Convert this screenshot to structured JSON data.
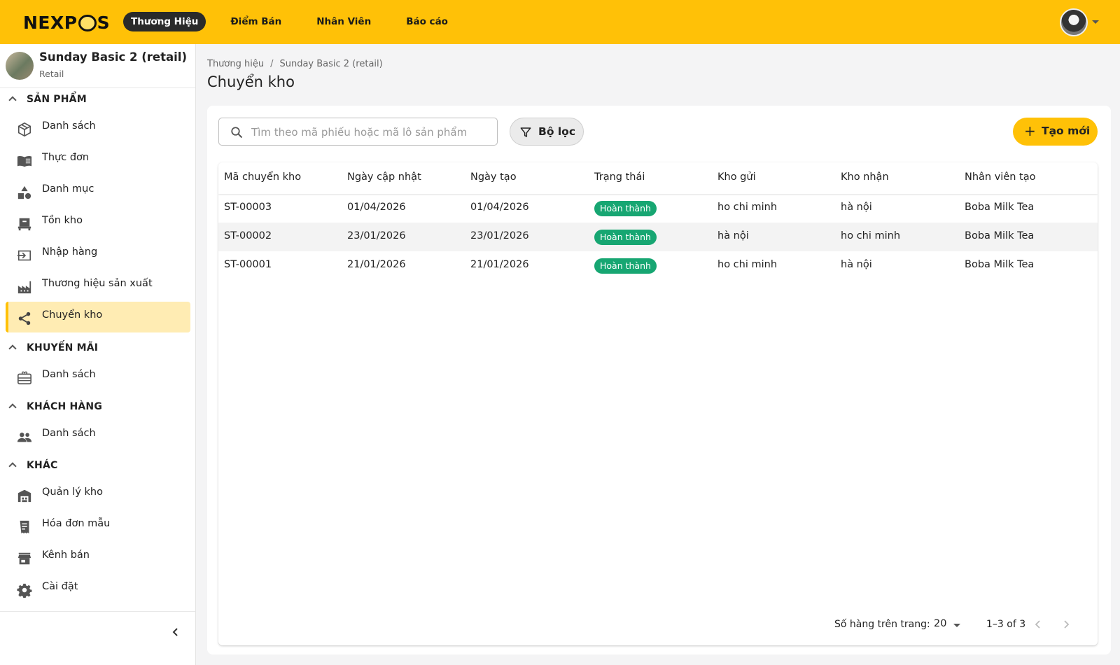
{
  "header": {
    "logo_text": "NEXPOS",
    "nav": [
      {
        "label": "Thương Hiệu",
        "active": true
      },
      {
        "label": "Điểm Bán",
        "active": false
      },
      {
        "label": "Nhân Viên",
        "active": false
      },
      {
        "label": "Báo cáo",
        "active": false
      }
    ],
    "accent_color": "#ffc107"
  },
  "store": {
    "name": "Sunday Basic 2 (retail)",
    "type": "Retail"
  },
  "sidebar": {
    "sections": [
      {
        "title": "SẢN PHẨM",
        "items": [
          {
            "label": "Danh sách",
            "icon": "box-icon"
          },
          {
            "label": "Thực đơn",
            "icon": "menu-book-icon"
          },
          {
            "label": "Danh mục",
            "icon": "category-shapes-icon"
          },
          {
            "label": "Tồn kho",
            "icon": "inventory-icon"
          },
          {
            "label": "Nhập hàng",
            "icon": "import-icon"
          },
          {
            "label": "Thương hiệu sản xuất",
            "icon": "factory-icon"
          },
          {
            "label": "Chuyển kho",
            "icon": "share-icon",
            "active": true
          }
        ]
      },
      {
        "title": "KHUYẾN MÃI",
        "items": [
          {
            "label": "Danh sách",
            "icon": "gift-card-icon"
          }
        ]
      },
      {
        "title": "KHÁCH HÀNG",
        "items": [
          {
            "label": "Danh sách",
            "icon": "people-icon"
          }
        ]
      },
      {
        "title": "KHÁC",
        "items": [
          {
            "label": "Quản lý kho",
            "icon": "warehouse-icon"
          },
          {
            "label": "Hóa đơn mẫu",
            "icon": "receipt-icon"
          },
          {
            "label": "Kênh bán",
            "icon": "store-icon"
          },
          {
            "label": "Cài đặt",
            "icon": "gear-icon"
          }
        ]
      }
    ]
  },
  "breadcrumb": [
    "Thương hiệu",
    "Sunday Basic 2 (retail)"
  ],
  "page_title": "Chuyển kho",
  "toolbar": {
    "search_placeholder": "Tìm theo mã phiếu hoặc mã lô sản phẩm",
    "search_value": "",
    "filter_label": "Bộ lọc",
    "create_label": "Tạo mới"
  },
  "table": {
    "columns": [
      "Mã chuyển kho",
      "Ngày cập nhật",
      "Ngày tạo",
      "Trạng thái",
      "Kho gửi",
      "Kho nhận",
      "Nhân viên tạo"
    ],
    "rows": [
      {
        "code": "ST-00003",
        "updated": "01/04/2026",
        "created": "01/04/2026",
        "status": "Hoàn thành",
        "from": "ho chi minh",
        "to": "hà nội",
        "staff": "Boba Milk Tea"
      },
      {
        "code": "ST-00002",
        "updated": "23/01/2026",
        "created": "23/01/2026",
        "status": "Hoàn thành",
        "from": "hà nội",
        "to": "ho chi minh",
        "staff": "Boba Milk Tea"
      },
      {
        "code": "ST-00001",
        "updated": "21/01/2026",
        "created": "21/01/2026",
        "status": "Hoàn thành",
        "from": "ho chi minh",
        "to": "hà nội",
        "staff": "Boba Milk Tea"
      }
    ],
    "status_color": "#17a672"
  },
  "pagination": {
    "rows_per_page_label": "Số hàng trên trang:",
    "rows_per_page": "20",
    "range": "1–3 of 3"
  }
}
